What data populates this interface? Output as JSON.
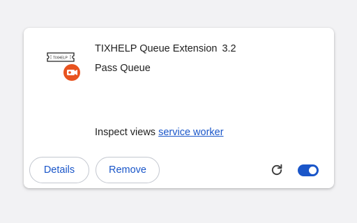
{
  "extension": {
    "name": "TIXHELP Queue Extension",
    "version": "3.2",
    "description": "Pass Queue",
    "inspect_label": "Inspect views",
    "inspect_link": "service worker",
    "ticket_text": "TIXHELP",
    "enabled": true
  },
  "actions": {
    "details_label": "Details",
    "remove_label": "Remove"
  },
  "icons": {
    "extension": "ticket-with-camera-icon",
    "reload": "reload-icon",
    "toggle": "toggle-switch"
  },
  "colors": {
    "accent": "#1a56c9",
    "badge": "#e8531f"
  }
}
